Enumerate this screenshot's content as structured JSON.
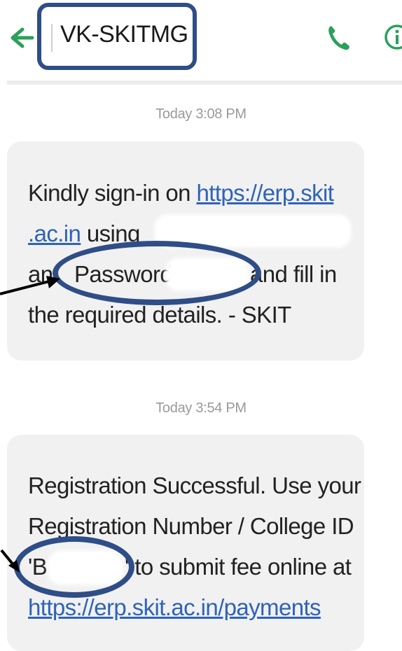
{
  "header": {
    "sender": "VK-SKITMG",
    "icons": {
      "back": "arrow-left-icon",
      "call": "phone-icon",
      "info": "info-icon"
    },
    "accent_color": "#2aa05a"
  },
  "messages": [
    {
      "timestamp": "Today 3:08 PM",
      "lines": [
        {
          "text": "Kindly sign-in on ",
          "link": "https://erp.skit"
        },
        {
          "link": ".ac.in",
          "text": " using"
        },
        {
          "text_start": "an",
          "text_mid": "Password:",
          "text_end": "and fill in"
        },
        {
          "text": "the required details. - SKIT"
        }
      ]
    },
    {
      "timestamp": "Today 3:54 PM",
      "lines": [
        {
          "text": "Registration Successful. Use your"
        },
        {
          "text": "Registration Number / College ID"
        },
        {
          "text_start": "'B",
          "text_end": "' to submit fee online at"
        },
        {
          "link": "https://erp.skit.ac.in/payments"
        }
      ]
    }
  ],
  "colors": {
    "annotation": "#2f4d86",
    "link": "#2e63b8",
    "bubble": "#f1f1f1",
    "timestamp": "#9a9a9a"
  }
}
